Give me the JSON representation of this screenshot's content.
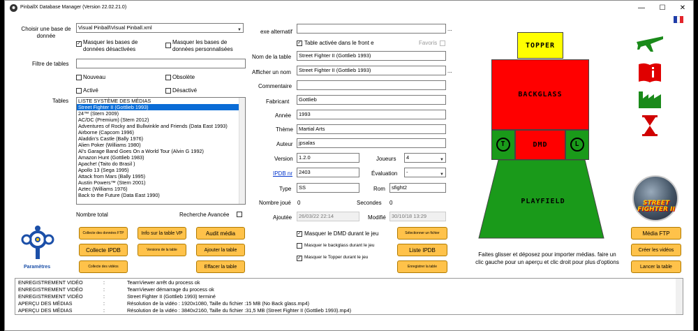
{
  "window": {
    "title": "PinballX Database Manager (Version 22.02.21.0)",
    "minimize": "—",
    "maximize": "☐",
    "close": "✕"
  },
  "left": {
    "db_label": "Choisir une base de donnée",
    "db_value": "Visual Pinball\\Visual Pinball.xml",
    "hide_disabled": "Masquer les bases de données désactivées",
    "hide_custom": "Masquer les bases de données personnalisées",
    "filter_label": "Filtre de tables",
    "filter_value": "",
    "new_label": "Nouveau",
    "obsolete_label": "Obsolète",
    "active_label": "Activé",
    "disabled_label": "Désactivé",
    "tables_label": "Tables",
    "tables": [
      "LISTE SYSTÈME DES MÉDIAS",
      "Street Fighter II (Gottlieb 1993)",
      "24™ (Stern 2009)",
      "AC/DC (Premium) (Stern 2012)",
      "Adventures of Rocky and Bullwinkle and Friends (Data East 1993)",
      "Airborne (Capcom 1996)",
      "Aladdin's Castle (Bally 1976)",
      "Alien Poker (Williams 1980)",
      "Al's Garage Band Goes On a World Tour (Alvin G 1992)",
      "Amazon Hunt (Gottlieb 1983)",
      "Apache! (Taito do Brasil )",
      "Apollo 13 (Sega 1995)",
      "Attack from Mars (Bally 1995)",
      "Austin Powers™ (Stern 2001)",
      "Aztec (Williams 1976)",
      "Back to the Future (Data East 1990)"
    ],
    "selected_index": 1,
    "total_label": "Nombre total",
    "advanced_search": "Recherche Avancée"
  },
  "settings": {
    "label": "Paramètres"
  },
  "buttons": {
    "collect_ftp": "Collecte des données FTP",
    "table_info": "Info sur la table VP",
    "audit": "Audit média",
    "collect_ipdb": "Collecte IPDB",
    "table_versions": "Versions de la table",
    "add_table": "Ajouter la table",
    "collect_videos": "Collecte des vidéos",
    "delete_table": "Effacer la table",
    "select_file": "Sélectionner un fichier",
    "ipdb_list": "Liste IPDB",
    "save_table": "Enregistrer la table",
    "media_ftp": "Média FTP",
    "create_videos": "Créer les vidéos",
    "launch_table": "Lancer la table"
  },
  "form": {
    "exe_alt_label": "exe alternatif",
    "exe_alt_value": "",
    "table_active_label": "Table activée dans le front e",
    "favorites_label": "Favoris",
    "table_name_label": "Nom de la table",
    "table_name_value": "Street Fighter II (Gottlieb 1993)",
    "display_name_label": "Afficher un nom",
    "display_name_value": "Street Fighter II (Gottlieb 1993)",
    "comment_label": "Commentaire",
    "comment_value": "",
    "maker_label": "Fabricant",
    "maker_value": "Gottlieb",
    "year_label": "Année",
    "year_value": "1993",
    "theme_label": "Thème",
    "theme_value": "Martial Arts",
    "author_label": "Auteur",
    "author_value": "jpsalas",
    "version_label": "Version",
    "version_value": "1.2.0",
    "players_label": "Joueurs",
    "players_value": "4",
    "ipdb_label": "IPDB nr",
    "ipdb_value": "2403",
    "rating_label": "Évaluation",
    "rating_value": "-",
    "type_label": "Type",
    "type_value": "SS",
    "rom_label": "Rom",
    "rom_value": "sfight2",
    "played_label": "Nombre joué",
    "played_value": "0",
    "seconds_label": "Secondes",
    "seconds_value": "0",
    "added_label": "Ajoutée",
    "added_value": "26/03/22 22:14",
    "modified_label": "Modifié",
    "modified_value": "30/10/18 13:29",
    "hide_dmd": "Masquer le DMD durant le jeu",
    "hide_backglass": "Masquer le backglass durant le jeu",
    "hide_topper": "Masquer le Topper durant le jeu",
    "ellipsis": "..."
  },
  "cabinet": {
    "topper": "TOPPER",
    "backglass": "BACKGLASS",
    "dmd": "DMD",
    "t": "T",
    "l": "L",
    "playfield": "PLAYFIELD",
    "colors": {
      "topper": "#ffff00",
      "backglass": "#ff0000",
      "green": "#1a9a1a"
    }
  },
  "right": {
    "hint": "Faites glisser et déposez pour importer médias. faire un clic gauche pour un aperçu et clic droit pour plus d'options",
    "wheel_title_lines": [
      "STREET",
      "FIGHTER II"
    ]
  },
  "log": {
    "rows": [
      {
        "cat": "ENREGISTREMENT VIDÉO",
        "sep": ":",
        "msg": "TeamViewer arrêt du process ok"
      },
      {
        "cat": "ENREGISTREMENT VIDÉO",
        "sep": ":",
        "msg": "TeamViewer démarrage du process ok"
      },
      {
        "cat": "ENREGISTREMENT VIDÉO",
        "sep": ":",
        "msg": "Street Fighter II (Gottlieb 1993) terminé"
      },
      {
        "cat": "APERÇU DES MÉDIAS",
        "sep": ":",
        "msg": "Résolution de la vidéo : 1920x1080, Taille du fichier :15 MB (No Back glass.mp4)"
      },
      {
        "cat": "APERÇU DES MÉDIAS",
        "sep": ":",
        "msg": "Résolution de la vidéo : 3840x2160, Taille du fichier :31,5 MB (Street Fighter II (Gottlieb 1993).mp4)"
      }
    ]
  }
}
